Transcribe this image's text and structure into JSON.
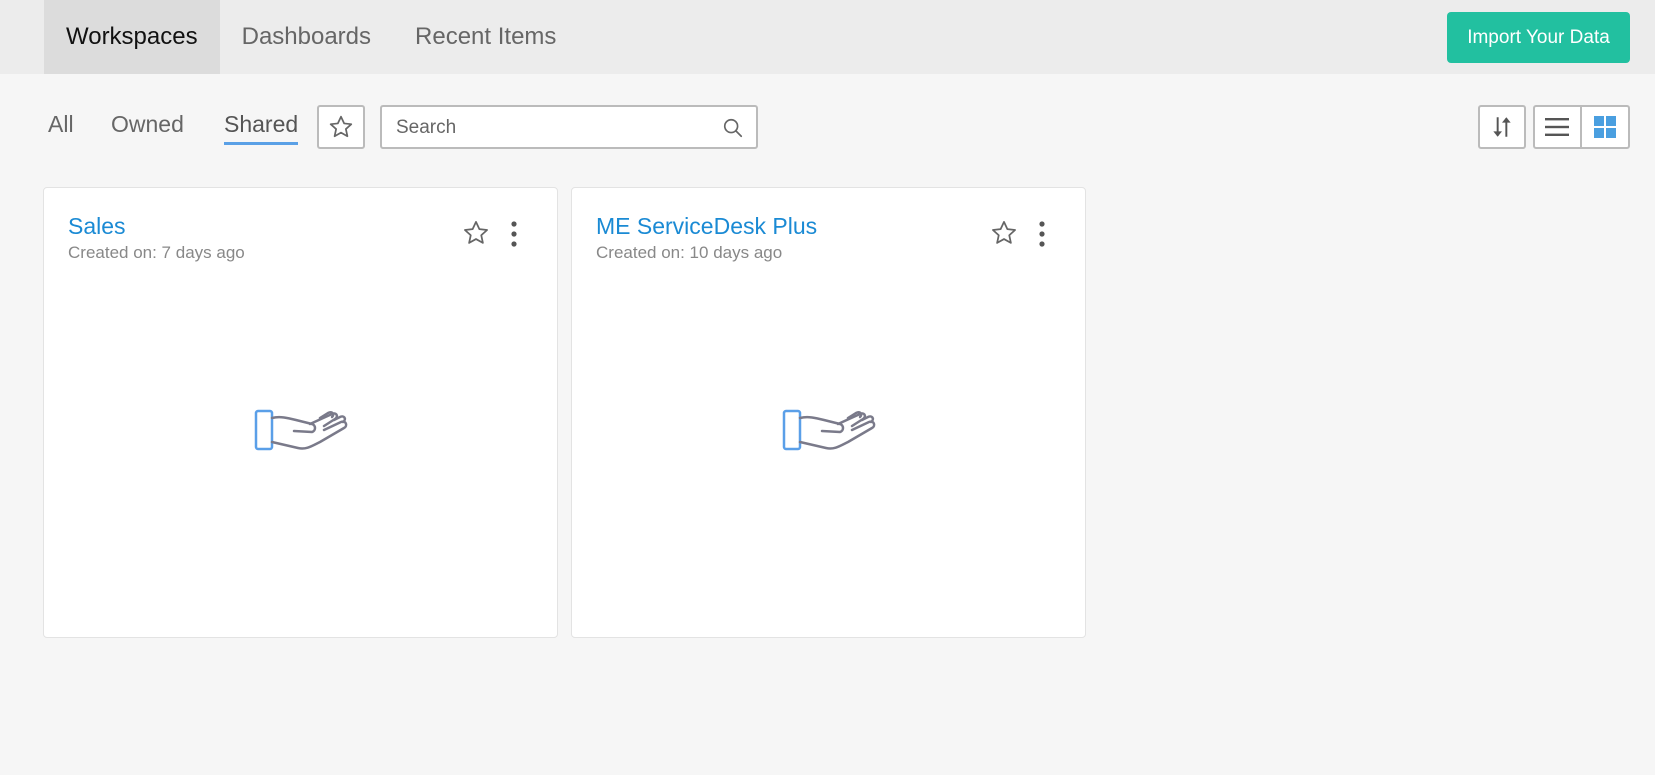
{
  "nav": {
    "tabs": [
      {
        "label": "Workspaces",
        "active": true
      },
      {
        "label": "Dashboards",
        "active": false
      },
      {
        "label": "Recent Items",
        "active": false
      }
    ],
    "import_label": "Import Your Data"
  },
  "filters": {
    "items": [
      {
        "label": "All",
        "active": false
      },
      {
        "label": "Owned",
        "active": false
      },
      {
        "label": "Shared",
        "active": true
      }
    ],
    "search_placeholder": "Search"
  },
  "view": {
    "mode": "grid"
  },
  "colors": {
    "accent": "#22c0a0",
    "link": "#1a8ad4",
    "grid_active": "#4a9fe0"
  },
  "workspaces": [
    {
      "title": "Sales",
      "created": "Created on: 7 days ago"
    },
    {
      "title": "ME ServiceDesk Plus",
      "created": "Created on: 10 days ago"
    }
  ]
}
